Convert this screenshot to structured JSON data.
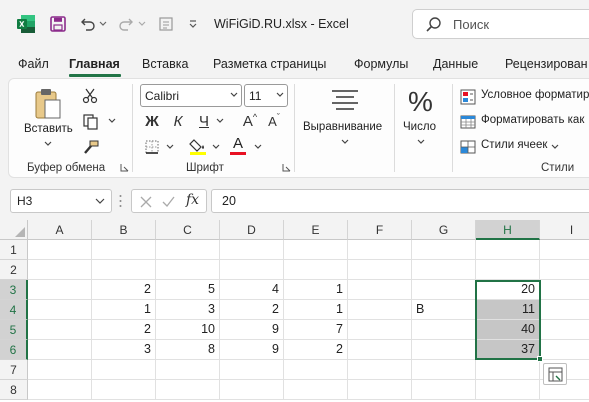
{
  "titlebar": {
    "filename": "WiFiGiD.RU.xlsx  -  Excel",
    "search_placeholder": "Поиск",
    "colors": {
      "excel_green": "#217346",
      "save_purple": "#8b2b8b"
    }
  },
  "tabs": [
    "Файл",
    "Главная",
    "Вставка",
    "Разметка страницы",
    "Формулы",
    "Данные",
    "Рецензирован"
  ],
  "active_tab": "Главная",
  "ribbon": {
    "clipboard": {
      "paste_label": "Вставить",
      "group_label": "Буфер обмена"
    },
    "font": {
      "font_name": "Calibri",
      "font_size": "11",
      "bold": "Ж",
      "italic": "К",
      "underline": "Ч",
      "grow": "A",
      "shrink": "A",
      "fill_letter": "",
      "font_color_letter": "A",
      "group_label": "Шрифт",
      "fill_color": "#ffff00",
      "font_color": "#e81123"
    },
    "alignment": {
      "label": "Выравнивание"
    },
    "number": {
      "label": "Число"
    },
    "styles": {
      "conditional": "Условное форматир",
      "format_table": "Форматировать как",
      "cell_styles": "Стили ячеек",
      "group_label": "Стили"
    }
  },
  "formula_bar": {
    "name_box": "H3",
    "value": "20"
  },
  "grid": {
    "columns": [
      "A",
      "B",
      "C",
      "D",
      "E",
      "F",
      "G",
      "H",
      "I"
    ],
    "selected_column": "H",
    "rows": [
      "1",
      "2",
      "3",
      "4",
      "5",
      "6",
      "7",
      "8"
    ],
    "selected_rows": [
      "3",
      "4",
      "5",
      "6"
    ],
    "cells": {
      "B3": "2",
      "C3": "5",
      "D3": "4",
      "E3": "1",
      "H3": "20",
      "B4": "1",
      "C4": "3",
      "D4": "2",
      "E4": "1",
      "G4": "B",
      "H4": "11",
      "B5": "2",
      "C5": "10",
      "D5": "9",
      "E5": "7",
      "H5": "40",
      "B6": "3",
      "C6": "8",
      "D6": "9",
      "E6": "2",
      "H6": "37"
    }
  }
}
